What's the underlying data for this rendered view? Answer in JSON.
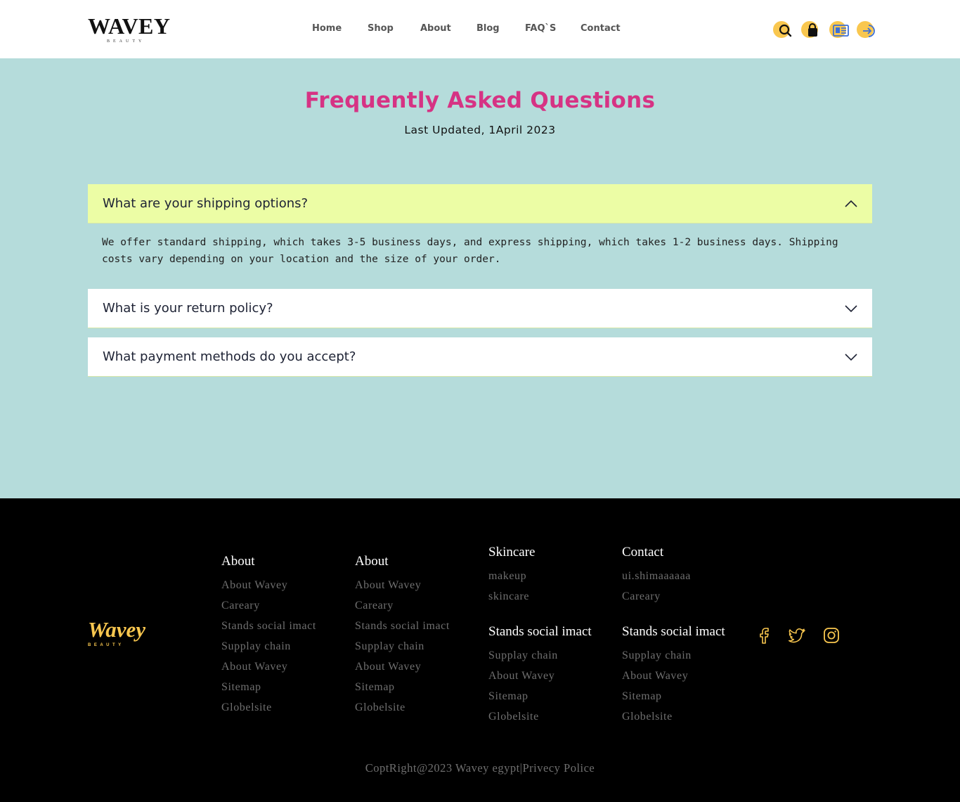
{
  "brand": {
    "name": "WAVEY",
    "tagline": "BEAUTY"
  },
  "nav": {
    "items": [
      {
        "label": "Home"
      },
      {
        "label": "Shop"
      },
      {
        "label": "About"
      },
      {
        "label": "Blog"
      },
      {
        "label": "FAQ`S"
      },
      {
        "label": "Contact"
      }
    ]
  },
  "header_icons": [
    "search-icon",
    "shopping-bag-icon",
    "id-card-icon",
    "login-icon"
  ],
  "colors": {
    "accent": "#f9c74f",
    "title": "#d63384",
    "page_bg": "#b5dcdb",
    "open_item_bg": "#ecfda5",
    "footer_bg": "#000000"
  },
  "faq": {
    "title": "Frequently Asked Questions",
    "updated": "Last Updated, 1April 2023",
    "items": [
      {
        "question": "What are your shipping options?",
        "expanded": true,
        "answer": "We offer standard shipping, which takes 3-5 business days, and express shipping, which takes 1-2 business days. Shipping costs vary depending on your location and the size of your order."
      },
      {
        "question": "What is your return policy?",
        "expanded": false
      },
      {
        "question": "What payment methods do you accept?",
        "expanded": false
      }
    ]
  },
  "footer": {
    "logo": {
      "name": "Wavey",
      "tagline": "BEAUTY"
    },
    "columns": [
      {
        "heading": "About",
        "links": [
          "About Wavey",
          "Careary",
          "Stands social imact",
          "Supplay chain",
          "About Wavey",
          "Sitemap",
          "Globelsite"
        ]
      },
      {
        "heading": "About",
        "links": [
          "About Wavey",
          "Careary",
          "Stands social imact",
          "Supplay chain",
          "About Wavey",
          "Sitemap",
          "Globelsite"
        ]
      },
      {
        "heading": "Skincare",
        "links": [
          "makeup",
          "skincare"
        ],
        "heading2": "Stands social imact",
        "links2": [
          "Supplay chain",
          "About Wavey",
          "Sitemap",
          "Globelsite"
        ]
      },
      {
        "heading": "Contact",
        "links": [
          "ui.shimaaaaaa",
          "Careary"
        ],
        "heading2": "Stands social imact",
        "links2": [
          "Supplay chain",
          "About Wavey",
          "Sitemap",
          "Globelsite"
        ]
      }
    ],
    "social_icons": [
      "facebook-icon",
      "twitter-icon",
      "instagram-icon"
    ],
    "copyright": "CoptRight@2023 Wavey egypt|Privecy Police"
  }
}
